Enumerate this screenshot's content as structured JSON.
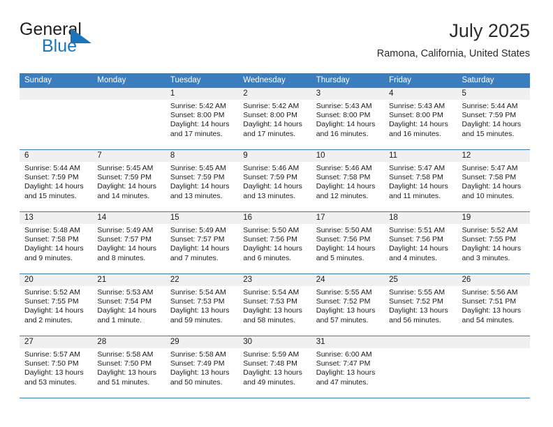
{
  "brand": {
    "name_part1": "General",
    "name_part2": "Blue",
    "logo_icon": "triangle-logo-icon",
    "accent_color": "#1b75bb"
  },
  "header": {
    "title": "July 2025",
    "location": "Ramona, California, United States"
  },
  "calendar": {
    "header_bg": "#3a7ebf",
    "band_bg": "#f0f0f0",
    "weekdays": [
      "Sunday",
      "Monday",
      "Tuesday",
      "Wednesday",
      "Thursday",
      "Friday",
      "Saturday"
    ],
    "weeks": [
      [
        {
          "day": "",
          "sunrise": "",
          "sunset": "",
          "daylight1": "",
          "daylight2": "",
          "empty": true
        },
        {
          "day": "",
          "sunrise": "",
          "sunset": "",
          "daylight1": "",
          "daylight2": "",
          "empty": true
        },
        {
          "day": "1",
          "sunrise": "Sunrise: 5:42 AM",
          "sunset": "Sunset: 8:00 PM",
          "daylight1": "Daylight: 14 hours",
          "daylight2": "and 17 minutes."
        },
        {
          "day": "2",
          "sunrise": "Sunrise: 5:42 AM",
          "sunset": "Sunset: 8:00 PM",
          "daylight1": "Daylight: 14 hours",
          "daylight2": "and 17 minutes."
        },
        {
          "day": "3",
          "sunrise": "Sunrise: 5:43 AM",
          "sunset": "Sunset: 8:00 PM",
          "daylight1": "Daylight: 14 hours",
          "daylight2": "and 16 minutes."
        },
        {
          "day": "4",
          "sunrise": "Sunrise: 5:43 AM",
          "sunset": "Sunset: 8:00 PM",
          "daylight1": "Daylight: 14 hours",
          "daylight2": "and 16 minutes."
        },
        {
          "day": "5",
          "sunrise": "Sunrise: 5:44 AM",
          "sunset": "Sunset: 7:59 PM",
          "daylight1": "Daylight: 14 hours",
          "daylight2": "and 15 minutes."
        }
      ],
      [
        {
          "day": "6",
          "sunrise": "Sunrise: 5:44 AM",
          "sunset": "Sunset: 7:59 PM",
          "daylight1": "Daylight: 14 hours",
          "daylight2": "and 15 minutes."
        },
        {
          "day": "7",
          "sunrise": "Sunrise: 5:45 AM",
          "sunset": "Sunset: 7:59 PM",
          "daylight1": "Daylight: 14 hours",
          "daylight2": "and 14 minutes."
        },
        {
          "day": "8",
          "sunrise": "Sunrise: 5:45 AM",
          "sunset": "Sunset: 7:59 PM",
          "daylight1": "Daylight: 14 hours",
          "daylight2": "and 13 minutes."
        },
        {
          "day": "9",
          "sunrise": "Sunrise: 5:46 AM",
          "sunset": "Sunset: 7:59 PM",
          "daylight1": "Daylight: 14 hours",
          "daylight2": "and 13 minutes."
        },
        {
          "day": "10",
          "sunrise": "Sunrise: 5:46 AM",
          "sunset": "Sunset: 7:58 PM",
          "daylight1": "Daylight: 14 hours",
          "daylight2": "and 12 minutes."
        },
        {
          "day": "11",
          "sunrise": "Sunrise: 5:47 AM",
          "sunset": "Sunset: 7:58 PM",
          "daylight1": "Daylight: 14 hours",
          "daylight2": "and 11 minutes."
        },
        {
          "day": "12",
          "sunrise": "Sunrise: 5:47 AM",
          "sunset": "Sunset: 7:58 PM",
          "daylight1": "Daylight: 14 hours",
          "daylight2": "and 10 minutes."
        }
      ],
      [
        {
          "day": "13",
          "sunrise": "Sunrise: 5:48 AM",
          "sunset": "Sunset: 7:58 PM",
          "daylight1": "Daylight: 14 hours",
          "daylight2": "and 9 minutes."
        },
        {
          "day": "14",
          "sunrise": "Sunrise: 5:49 AM",
          "sunset": "Sunset: 7:57 PM",
          "daylight1": "Daylight: 14 hours",
          "daylight2": "and 8 minutes."
        },
        {
          "day": "15",
          "sunrise": "Sunrise: 5:49 AM",
          "sunset": "Sunset: 7:57 PM",
          "daylight1": "Daylight: 14 hours",
          "daylight2": "and 7 minutes."
        },
        {
          "day": "16",
          "sunrise": "Sunrise: 5:50 AM",
          "sunset": "Sunset: 7:56 PM",
          "daylight1": "Daylight: 14 hours",
          "daylight2": "and 6 minutes."
        },
        {
          "day": "17",
          "sunrise": "Sunrise: 5:50 AM",
          "sunset": "Sunset: 7:56 PM",
          "daylight1": "Daylight: 14 hours",
          "daylight2": "and 5 minutes."
        },
        {
          "day": "18",
          "sunrise": "Sunrise: 5:51 AM",
          "sunset": "Sunset: 7:56 PM",
          "daylight1": "Daylight: 14 hours",
          "daylight2": "and 4 minutes."
        },
        {
          "day": "19",
          "sunrise": "Sunrise: 5:52 AM",
          "sunset": "Sunset: 7:55 PM",
          "daylight1": "Daylight: 14 hours",
          "daylight2": "and 3 minutes."
        }
      ],
      [
        {
          "day": "20",
          "sunrise": "Sunrise: 5:52 AM",
          "sunset": "Sunset: 7:55 PM",
          "daylight1": "Daylight: 14 hours",
          "daylight2": "and 2 minutes."
        },
        {
          "day": "21",
          "sunrise": "Sunrise: 5:53 AM",
          "sunset": "Sunset: 7:54 PM",
          "daylight1": "Daylight: 14 hours",
          "daylight2": "and 1 minute."
        },
        {
          "day": "22",
          "sunrise": "Sunrise: 5:54 AM",
          "sunset": "Sunset: 7:53 PM",
          "daylight1": "Daylight: 13 hours",
          "daylight2": "and 59 minutes."
        },
        {
          "day": "23",
          "sunrise": "Sunrise: 5:54 AM",
          "sunset": "Sunset: 7:53 PM",
          "daylight1": "Daylight: 13 hours",
          "daylight2": "and 58 minutes."
        },
        {
          "day": "24",
          "sunrise": "Sunrise: 5:55 AM",
          "sunset": "Sunset: 7:52 PM",
          "daylight1": "Daylight: 13 hours",
          "daylight2": "and 57 minutes."
        },
        {
          "day": "25",
          "sunrise": "Sunrise: 5:55 AM",
          "sunset": "Sunset: 7:52 PM",
          "daylight1": "Daylight: 13 hours",
          "daylight2": "and 56 minutes."
        },
        {
          "day": "26",
          "sunrise": "Sunrise: 5:56 AM",
          "sunset": "Sunset: 7:51 PM",
          "daylight1": "Daylight: 13 hours",
          "daylight2": "and 54 minutes."
        }
      ],
      [
        {
          "day": "27",
          "sunrise": "Sunrise: 5:57 AM",
          "sunset": "Sunset: 7:50 PM",
          "daylight1": "Daylight: 13 hours",
          "daylight2": "and 53 minutes."
        },
        {
          "day": "28",
          "sunrise": "Sunrise: 5:58 AM",
          "sunset": "Sunset: 7:50 PM",
          "daylight1": "Daylight: 13 hours",
          "daylight2": "and 51 minutes."
        },
        {
          "day": "29",
          "sunrise": "Sunrise: 5:58 AM",
          "sunset": "Sunset: 7:49 PM",
          "daylight1": "Daylight: 13 hours",
          "daylight2": "and 50 minutes."
        },
        {
          "day": "30",
          "sunrise": "Sunrise: 5:59 AM",
          "sunset": "Sunset: 7:48 PM",
          "daylight1": "Daylight: 13 hours",
          "daylight2": "and 49 minutes."
        },
        {
          "day": "31",
          "sunrise": "Sunrise: 6:00 AM",
          "sunset": "Sunset: 7:47 PM",
          "daylight1": "Daylight: 13 hours",
          "daylight2": "and 47 minutes."
        },
        {
          "day": "",
          "sunrise": "",
          "sunset": "",
          "daylight1": "",
          "daylight2": "",
          "empty": true
        },
        {
          "day": "",
          "sunrise": "",
          "sunset": "",
          "daylight1": "",
          "daylight2": "",
          "empty": true
        }
      ]
    ]
  }
}
